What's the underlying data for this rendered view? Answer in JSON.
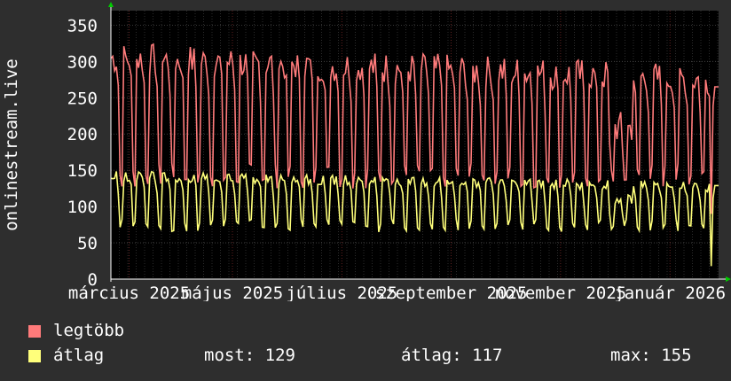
{
  "chart_data": {
    "type": "line",
    "ylabel": "onlinestream.live",
    "ylim": [
      0,
      370
    ],
    "y_ticks": [
      0,
      50,
      100,
      150,
      200,
      250,
      300,
      350
    ],
    "x_ticks": [
      {
        "label": "március 2025",
        "t": 0.03
      },
      {
        "label": "május 2025",
        "t": 0.2
      },
      {
        "label": "július 2025",
        "t": 0.38
      },
      {
        "label": "szeptember 2025",
        "t": 0.56
      },
      {
        "label": "november 2025",
        "t": 0.74
      },
      {
        "label": "január 2026",
        "t": 0.92
      }
    ],
    "grid": true,
    "colors": {
      "background": "#000000",
      "page": "#2e2e2e",
      "grid_minor": "#4a4a4a",
      "grid_major": "#7a2a2a",
      "max_series": "#ff7b7b",
      "avg_series": "#ffff7b",
      "arrow": "#00cc00"
    },
    "series": [
      {
        "name": "legtöbb",
        "key": "max"
      },
      {
        "name": "átlag",
        "key": "avg"
      }
    ]
  },
  "legend": {
    "max_label": "legtöbb",
    "avg_label": "átlag"
  },
  "stats": {
    "current": "most: 129",
    "average": "átlag: 117",
    "maximum": "max: 155"
  }
}
